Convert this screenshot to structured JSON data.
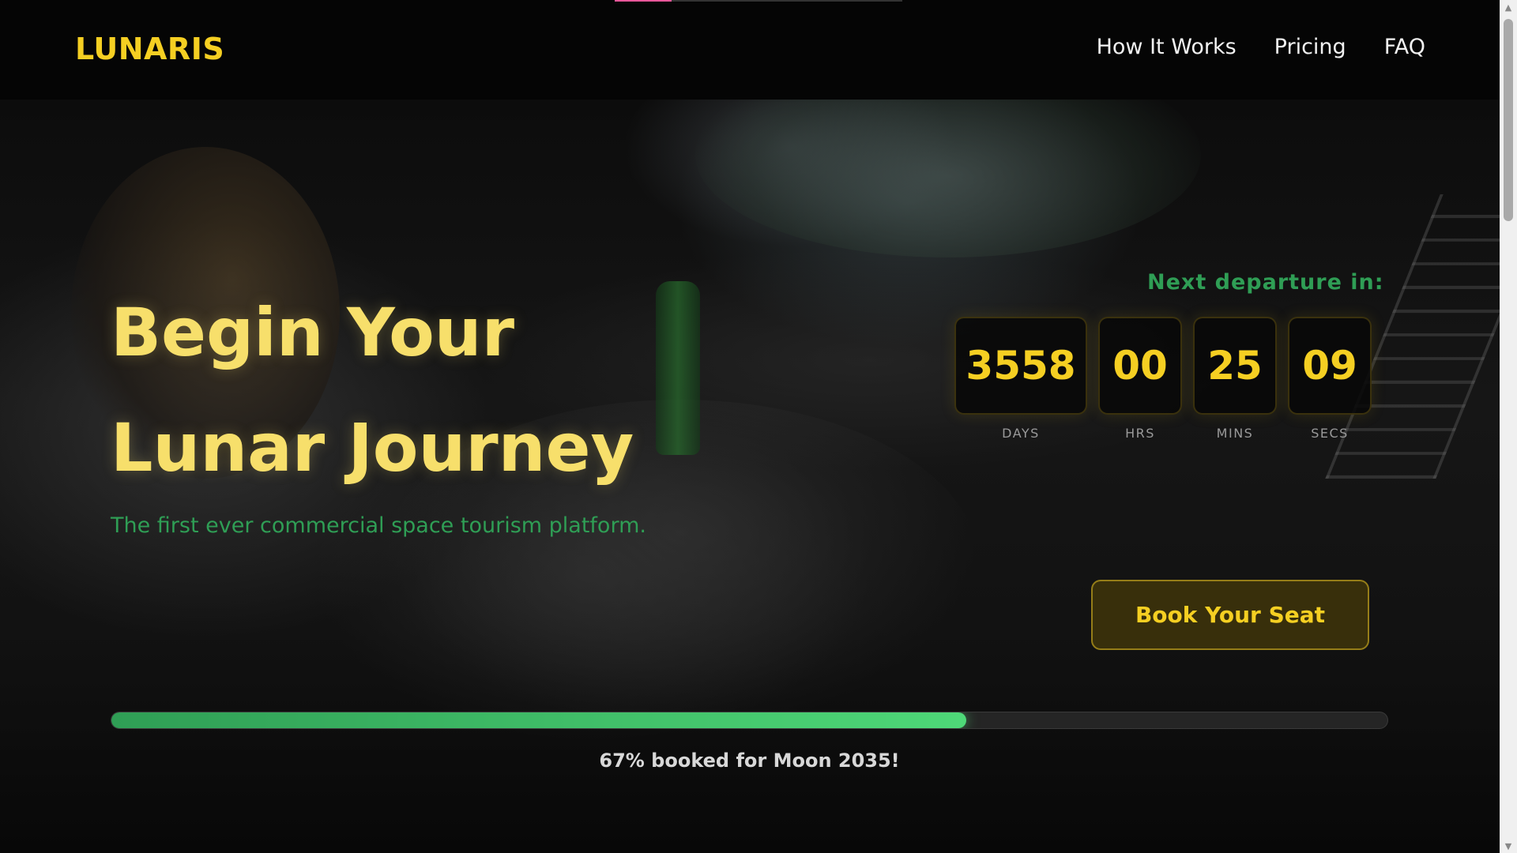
{
  "brand": {
    "logo_text": "LUNARIS",
    "accent": "#f5cf22",
    "green": "#2f9e55"
  },
  "nav": {
    "items": [
      {
        "label": "How It Works"
      },
      {
        "label": "Pricing"
      },
      {
        "label": "FAQ"
      }
    ]
  },
  "hero": {
    "title_line1": "Begin Your",
    "title_line2": "Lunar Journey",
    "subtitle": "The first ever commercial space tourism platform."
  },
  "countdown": {
    "label": "Next departure in:",
    "units": [
      {
        "value": "3558",
        "label": "DAYS"
      },
      {
        "value": "00",
        "label": "HRS"
      },
      {
        "value": "25",
        "label": "MINS"
      },
      {
        "value": "09",
        "label": "SECS"
      }
    ]
  },
  "cta": {
    "book_label": "Book Your Seat"
  },
  "booking": {
    "percent": 67,
    "text": "67% booked for Moon 2035!"
  },
  "icons": {
    "scroll_up": "chevron-up-icon",
    "scroll_down": "chevron-down-icon"
  }
}
